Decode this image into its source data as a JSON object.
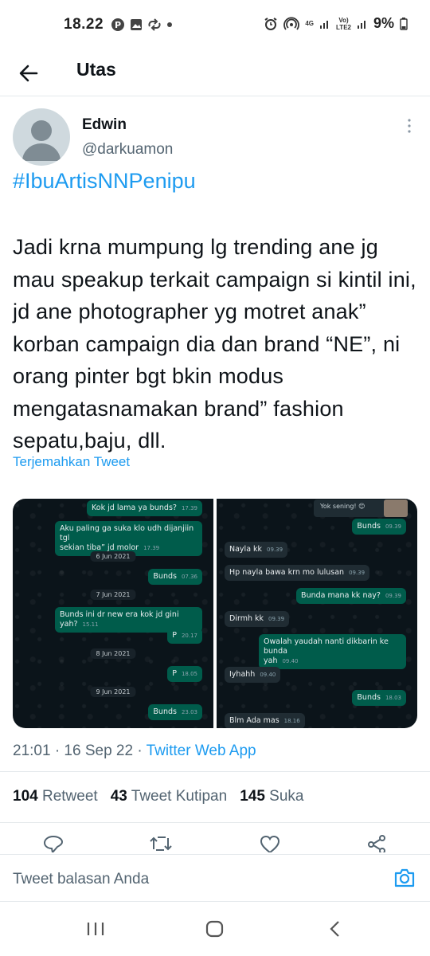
{
  "status_bar": {
    "time": "18.22",
    "battery": "9%",
    "network_top": "4G",
    "volte": "Vo)\nLTE2"
  },
  "header": {
    "title": "Utas"
  },
  "tweet": {
    "author_name": "Edwin",
    "author_handle": "@darkuamon",
    "hashtag": "#IbuArtisNNPenipu",
    "text": "Jadi krna mumpung lg trending ane jg mau speakup terkait campaign si kintil ini, jd ane photographer yg motret anak” korban campaign dia dan brand “NE”, ni orang pinter bgt bkin modus mengatasnamakan brand” fashion sepatu,baju, dll.",
    "translate_label": "Terjemahkan Tweet",
    "timestamp": "21:01 · 16 Sep 22 · ",
    "source_app": "Twitter Web App",
    "stats": {
      "retweets": "104",
      "retweets_label": "Retweet",
      "quotes": "43",
      "quotes_label": "Tweet Kutipan",
      "likes": "145",
      "likes_label": "Suka"
    }
  },
  "media": {
    "left_chat": [
      {
        "type": "out",
        "text": "Kok jd lama ya bunds?",
        "time": "17.39"
      },
      {
        "type": "out",
        "text": "Aku paling ga suka klo udh dijanjiin tgl\nsekian tiba” jd molor",
        "time": "17.39"
      },
      {
        "type": "date",
        "text": "6 Jun 2021"
      },
      {
        "type": "out",
        "text": "Bunds",
        "time": "07.36"
      },
      {
        "type": "date",
        "text": "7 Jun 2021"
      },
      {
        "type": "out",
        "text": "Bunds ini dr new era kok jd gini yah?",
        "time": "15.11"
      },
      {
        "type": "out",
        "text": "P",
        "time": "20.17"
      },
      {
        "type": "date",
        "text": "8 Jun 2021"
      },
      {
        "type": "out",
        "text": "P",
        "time": "18.05"
      },
      {
        "type": "date",
        "text": "9 Jun 2021"
      },
      {
        "type": "out",
        "text": "Bunds",
        "time": "23.03"
      }
    ],
    "right_chat": {
      "quote": "Yok sening! 😊",
      "messages": [
        {
          "type": "out",
          "text": "Bunds",
          "time": "09.39"
        },
        {
          "type": "in",
          "text": "Nayla kk",
          "time": "09.39"
        },
        {
          "type": "in",
          "text": "Hp nayla bawa krn mo lulusan",
          "time": "09.39"
        },
        {
          "type": "out",
          "text": "Bunda mana kk nay?",
          "time": "09.39"
        },
        {
          "type": "in",
          "text": "Dirmh kk",
          "time": "09.39"
        },
        {
          "type": "out",
          "text": "Owalah yaudah nanti dikbarin ke bunda\nyah",
          "time": "09.40"
        },
        {
          "type": "in",
          "text": "Iyhahh",
          "time": "09.40"
        },
        {
          "type": "out",
          "text": "Bunds",
          "time": "18.03"
        },
        {
          "type": "in",
          "text": "Blm Ada mas",
          "time": "18.16"
        }
      ]
    }
  },
  "reply": {
    "placeholder": "Tweet balasan Anda"
  },
  "colors": {
    "accent": "#1d9bf0",
    "text_primary": "#0f1419",
    "text_secondary": "#536471",
    "chat_bg": "#0b141a",
    "bubble_out": "#005c4b",
    "bubble_in": "#202c33"
  },
  "icons": [
    "arrow-left-icon",
    "more-vertical-icon",
    "reply-icon",
    "retweet-icon",
    "heart-icon",
    "share-icon",
    "camera-icon",
    "recents-icon",
    "home-icon",
    "back-icon"
  ]
}
